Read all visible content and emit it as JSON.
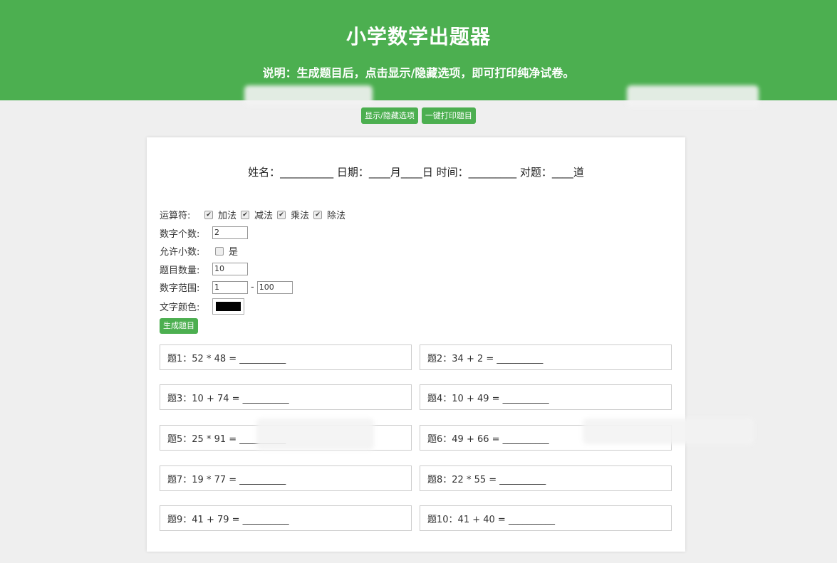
{
  "header": {
    "title": "小学数学出题器",
    "subtitle": "说明：生成题目后，点击显示/隐藏选项，即可打印纯净试卷。"
  },
  "toolbar": {
    "toggle_label": "显示/隐藏选项",
    "print_label": "一键打印题目"
  },
  "info_line": "姓名：__________ 日期：____月____日 时间：_________ 对题：____道",
  "form": {
    "operator_label": "运算符:",
    "operators": [
      {
        "label": "加法",
        "checked": true
      },
      {
        "label": "减法",
        "checked": true
      },
      {
        "label": "乘法",
        "checked": true
      },
      {
        "label": "除法",
        "checked": true
      }
    ],
    "count_label": "数字个数:",
    "count_value": "2",
    "decimal_label": "允许小数:",
    "decimal_option": "是",
    "decimal_checked": false,
    "quantity_label": "题目数量:",
    "quantity_value": "10",
    "range_label": "数字范围:",
    "range_min": "1",
    "range_sep": "-",
    "range_max": "100",
    "color_label": "文字颜色:",
    "color_value": "#000000",
    "generate_label": "生成题目"
  },
  "questions": [
    "题1：52 * 48 = __________",
    "题2：34 + 2 = __________",
    "题3：10 + 74 = __________",
    "题4：10 + 49 = __________",
    "题5：25 * 91 = __________",
    "题6：49 + 66 = __________",
    "题7：19 * 77 = __________",
    "题8：22 * 55 = __________",
    "题9：41 + 79 = __________",
    "题10：41 + 40 = __________"
  ],
  "colors": {
    "accent": "#4caf50",
    "background": "#efefef"
  }
}
